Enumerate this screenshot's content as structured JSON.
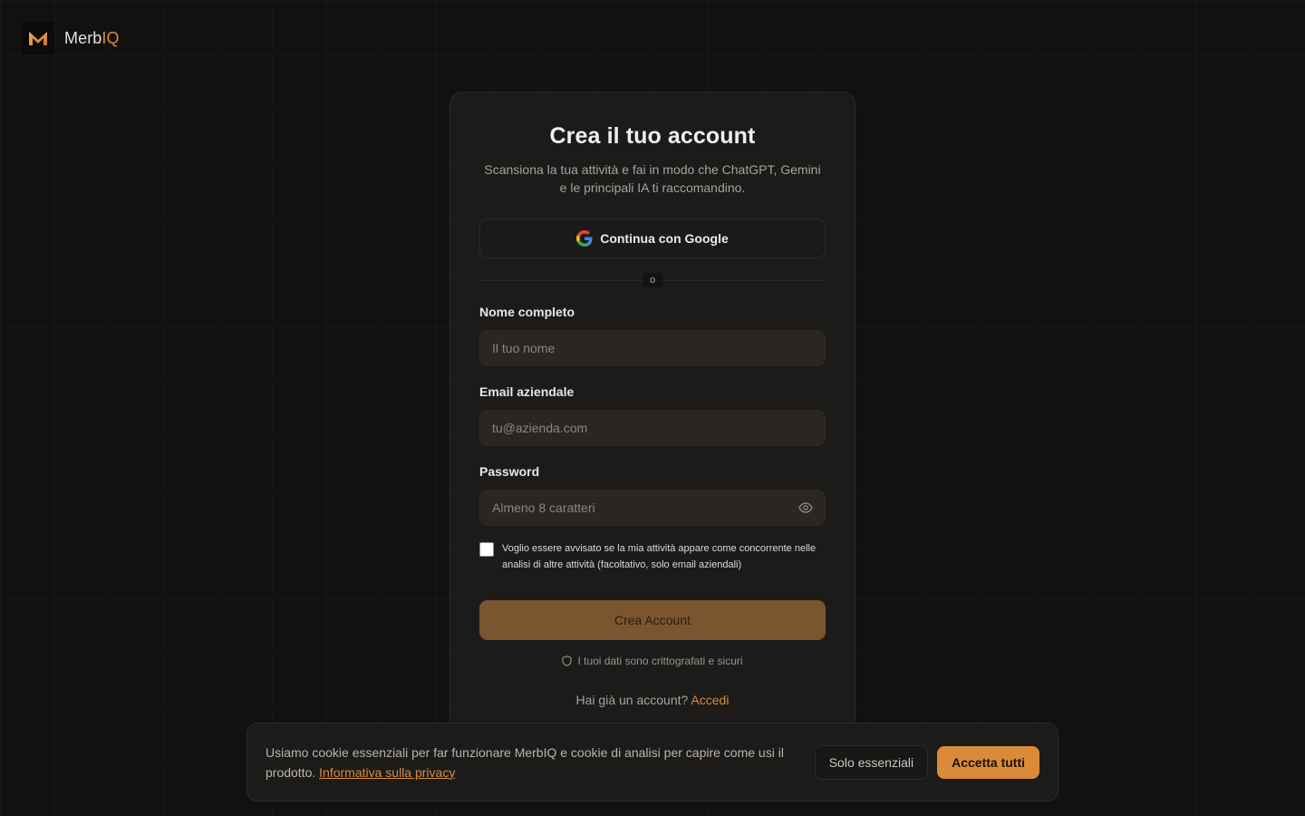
{
  "brand": {
    "name_prefix": "Merb",
    "name_accent": "IQ",
    "logo_letter": "M"
  },
  "signup": {
    "title": "Crea il tuo account",
    "subtitle": "Scansiona la tua attività e fai in modo che ChatGPT, Gemini e le principali IA ti raccomandino.",
    "google_button": "Continua con Google",
    "divider_text": "o",
    "fields": {
      "name": {
        "label": "Nome completo",
        "placeholder": "Il tuo nome"
      },
      "email": {
        "label": "Email aziendale",
        "placeholder": "tu@azienda.com"
      },
      "password": {
        "label": "Password",
        "placeholder": "Almeno 8 caratteri"
      }
    },
    "consent": "Voglio essere avvisato se la mia attività appare come concorrente nelle analisi di altre attività (facoltativo, solo email aziendali)",
    "submit": "Crea Account",
    "secure_note": "I tuoi dati sono crittografati e sicuri",
    "login_prompt": "Hai già un account?",
    "login_link": "Accedi"
  },
  "cookie": {
    "text": "Usiamo cookie essenziali per far funzionare MerbIQ e cookie di analisi per capire come usi il prodotto.",
    "privacy_link": "Informativa sulla privacy",
    "essential_button": "Solo essenziali",
    "accept_button": "Accetta tutti"
  },
  "icons": [
    "google-icon",
    "eye-icon",
    "shield-icon"
  ],
  "colors": {
    "accent": "#d98b3a",
    "submit_bg": "#7a5530",
    "background": "#121110",
    "card": "#1c1b1a"
  }
}
